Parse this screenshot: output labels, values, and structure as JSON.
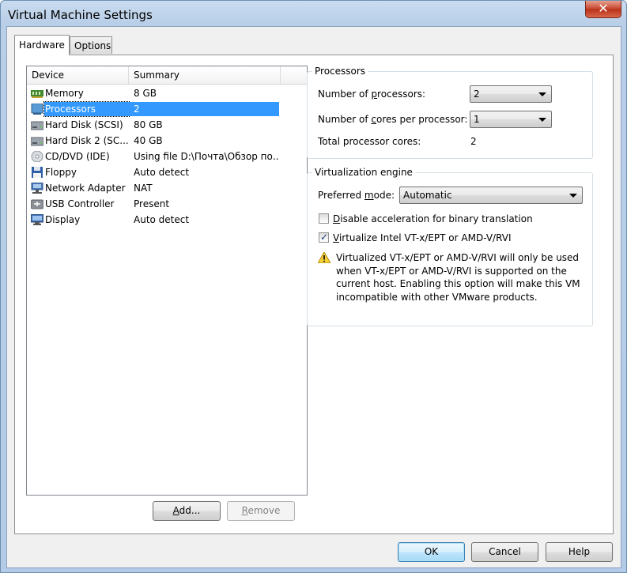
{
  "window": {
    "title": "Virtual Machine Settings",
    "close_glyph": "✕"
  },
  "tabs": [
    {
      "label": "Hardware",
      "active": true
    },
    {
      "label": "Options",
      "active": false
    }
  ],
  "device_list": {
    "columns": [
      "Device",
      "Summary"
    ],
    "rows": [
      {
        "icon": "memory-icon",
        "name": "Memory",
        "summary": "8 GB",
        "selected": false
      },
      {
        "icon": "processor-icon",
        "name": "Processors",
        "summary": "2",
        "selected": true
      },
      {
        "icon": "hard-disk-icon",
        "name": "Hard Disk (SCSI)",
        "summary": "80 GB",
        "selected": false
      },
      {
        "icon": "hard-disk-icon",
        "name": "Hard Disk 2 (SC...",
        "summary": "40 GB",
        "selected": false
      },
      {
        "icon": "cd-dvd-icon",
        "name": "CD/DVD (IDE)",
        "summary": "Using file D:\\Почта\\Обзор по...",
        "selected": false
      },
      {
        "icon": "floppy-icon",
        "name": "Floppy",
        "summary": "Auto detect",
        "selected": false
      },
      {
        "icon": "network-adapter-icon",
        "name": "Network Adapter",
        "summary": "NAT",
        "selected": false
      },
      {
        "icon": "usb-controller-icon",
        "name": "USB Controller",
        "summary": "Present",
        "selected": false
      },
      {
        "icon": "display-icon",
        "name": "Display",
        "summary": "Auto detect",
        "selected": false
      }
    ]
  },
  "list_buttons": {
    "add": "Add...",
    "add_mnemonic": "A",
    "add_rest": "dd...",
    "remove": "Remove",
    "remove_mnemonic": "R",
    "remove_rest": "emove"
  },
  "processors": {
    "group_title": "Processors",
    "num_processors_label_pre": "Number of ",
    "num_processors_label_mn": "p",
    "num_processors_label_post": "rocessors:",
    "num_processors_value": "2",
    "cores_label_pre": "Number of ",
    "cores_label_mn": "c",
    "cores_label_post": "ores per processor:",
    "cores_value": "1",
    "total_label": "Total processor cores:",
    "total_value": "2"
  },
  "virtualization": {
    "group_title": "Virtualization engine",
    "mode_label_pre": "Preferred ",
    "mode_label_mn": "m",
    "mode_label_post": "ode:",
    "mode_value": "Automatic",
    "disable_accel_mn": "D",
    "disable_accel_rest": "isable acceleration for binary translation",
    "disable_accel_checked": false,
    "vtx_mn": "V",
    "vtx_rest": "irtualize Intel VT-x/EPT or AMD-V/RVI",
    "vtx_checked": true,
    "warning_lines": [
      "Virtualized VT-x/EPT or AMD-V/RVI will only be used",
      "when VT-x/EPT or AMD-V/RVI is supported on the",
      "current host. Enabling this option will make this VM",
      "incompatible with other VMware products."
    ]
  },
  "footer": {
    "ok": "OK",
    "cancel": "Cancel",
    "help": "Help"
  },
  "colors": {
    "selection": "#3399ff",
    "warning": "#f5d23c"
  }
}
